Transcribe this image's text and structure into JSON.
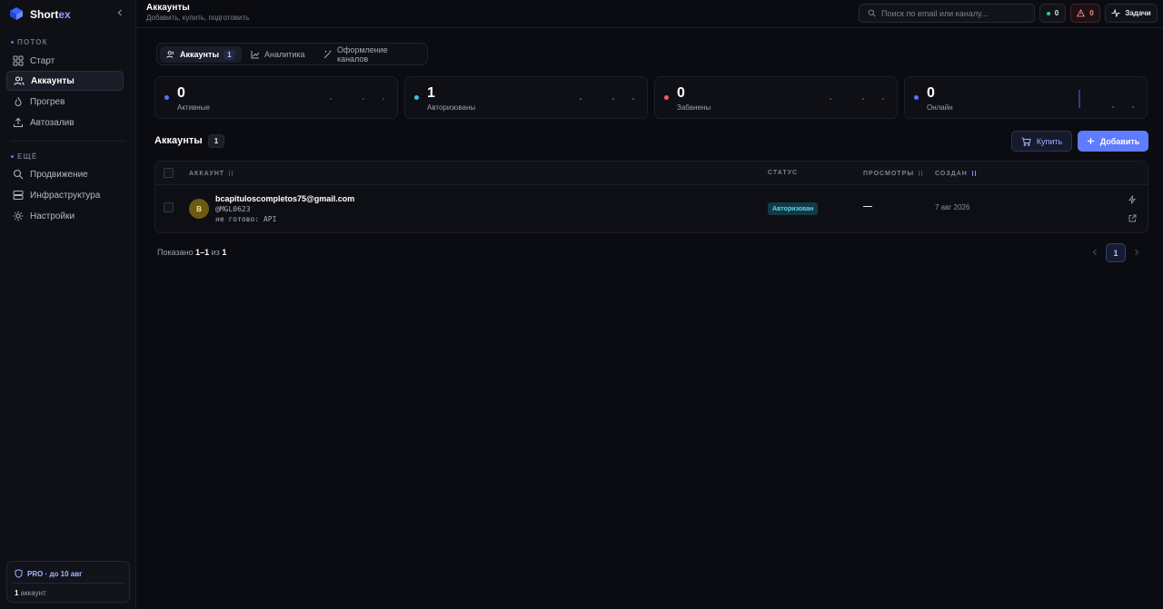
{
  "app": {
    "brand_main": "Short",
    "brand_accent": "ex"
  },
  "sidebar": {
    "section1": "ПОТОК",
    "items": [
      {
        "label": "Старт",
        "icon": "grid-icon"
      },
      {
        "label": "Аккаунты",
        "icon": "users-icon",
        "active": true
      },
      {
        "label": "Прогрев",
        "icon": "flame-icon"
      },
      {
        "label": "Автозалив",
        "icon": "upload-icon"
      }
    ],
    "section2": "ЕЩЁ",
    "items2": [
      {
        "label": "Продвижение",
        "icon": "search-icon"
      },
      {
        "label": "Инфраструктура",
        "icon": "server-icon"
      },
      {
        "label": "Настройки",
        "icon": "settings-icon"
      }
    ],
    "plan": {
      "label": "PRO · до 10 авг",
      "count": "1",
      "count_suffix": " аккаунт"
    }
  },
  "header": {
    "title": "Аккаунты",
    "subtitle": "Добавить, купить, подготовить",
    "search_placeholder": "Поиск по email или каналу...",
    "ok_count": "0",
    "alert_count": "0",
    "tasks_label": "Задачи"
  },
  "tabs": [
    {
      "label": "Аккаунты",
      "badge": "1",
      "active": true
    },
    {
      "label": "Аналитика"
    },
    {
      "label": "Оформление каналов"
    }
  ],
  "stats": [
    {
      "value": "0",
      "label": "Активные",
      "color": "#5b73ff"
    },
    {
      "value": "1",
      "label": "Авторизованы",
      "color": "#38c2e8"
    },
    {
      "value": "0",
      "label": "Забанены",
      "color": "#ff5a5a"
    },
    {
      "value": "0",
      "label": "Онлайн",
      "color": "#5b73ff"
    }
  ],
  "accounts": {
    "title": "Аккаунты",
    "count": "1",
    "buy_label": "Купить",
    "add_label": "Добавить",
    "columns": {
      "account": "АККАУНТ",
      "status": "СТАТУС",
      "views": "ПРОСМОТРЫ",
      "created": "СОЗДАН"
    },
    "rows": [
      {
        "avatar": "B",
        "email": "bcapituloscompletos75@gmail.com",
        "handle": "@MGL0623",
        "state": "не готово: API",
        "status": "Авторизован",
        "views": "—",
        "created": "7 авг 2026"
      }
    ]
  },
  "footer": {
    "shown_prefix": "Показано ",
    "shown_range": "1–1",
    "shown_mid": " из ",
    "shown_total": "1",
    "page": "1"
  }
}
